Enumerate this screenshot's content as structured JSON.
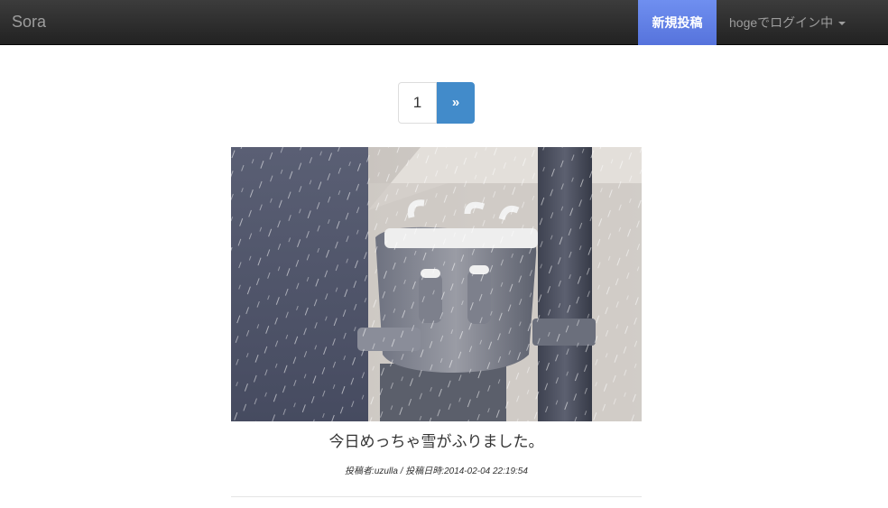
{
  "navbar": {
    "brand": "Sora",
    "new_post_label": "新規投稿",
    "user_label": "hogeでログイン中"
  },
  "pagination": {
    "pages": [
      "1"
    ],
    "next_label": "»"
  },
  "posts": [
    {
      "title": "今日めっちゃ雪がふりました。",
      "meta": "投稿者:uzulla / 投稿日時:2014-02-04 22:19:54"
    }
  ],
  "colors": {
    "navbar": "#222222",
    "accent": "#428bca",
    "new_post_bg": "#5f7fe6"
  }
}
